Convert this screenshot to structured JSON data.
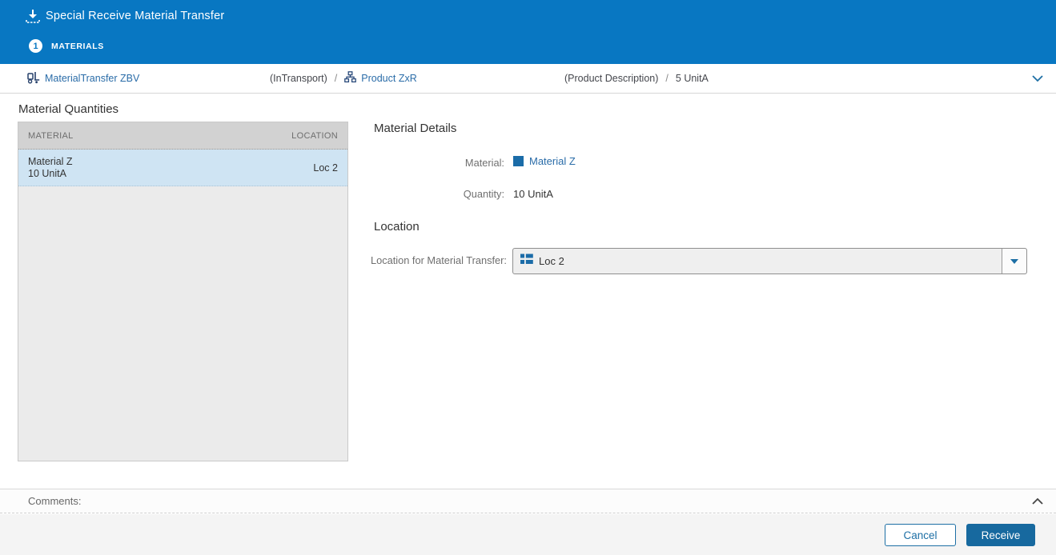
{
  "colors": {
    "header_bg": "#0877c2",
    "link": "#2a6ca8",
    "accent_button": "#17699f",
    "selected_row_bg": "#cfe4f3",
    "table_header_bg": "#d2d2d2",
    "table_body_bg": "#ebebeb",
    "footer_bg": "#f4f4f4"
  },
  "header": {
    "icon": "receive-download-icon",
    "title": "Special Receive Material Transfer",
    "step": {
      "number": "1",
      "label": "MATERIALS"
    }
  },
  "breadcrumb": {
    "transfer_icon": "material-transfer-cart-icon",
    "transfer_link": "MaterialTransfer ZBV",
    "transfer_status": "(InTransport)",
    "separator": "/",
    "product_icon": "product-hierarchy-icon",
    "product_link": "Product ZxR",
    "product_description": "(Product Description)",
    "product_quantity": "5 UnitA",
    "collapse_icon": "chevron-down-icon"
  },
  "material_quantities": {
    "title": "Material Quantities",
    "columns": {
      "material": "MATERIAL",
      "location": "LOCATION"
    },
    "rows": [
      {
        "material": "Material Z",
        "quantity": "10 UnitA",
        "location": "Loc 2",
        "selected": true
      }
    ]
  },
  "material_details": {
    "title": "Material Details",
    "material_label": "Material:",
    "material_icon": "material-swatch-icon",
    "material_value": "Material Z",
    "quantity_label": "Quantity:",
    "quantity_value": "10 UnitA"
  },
  "location_section": {
    "title": "Location",
    "field_label": "Location for Material Transfer:",
    "selected_icon": "location-grid-icon",
    "selected_value": "Loc 2",
    "dropdown_icon": "dropdown-arrow-icon"
  },
  "comments": {
    "label": "Comments:",
    "collapse_icon": "chevron-up-icon"
  },
  "footer": {
    "cancel_label": "Cancel",
    "receive_label": "Receive"
  }
}
